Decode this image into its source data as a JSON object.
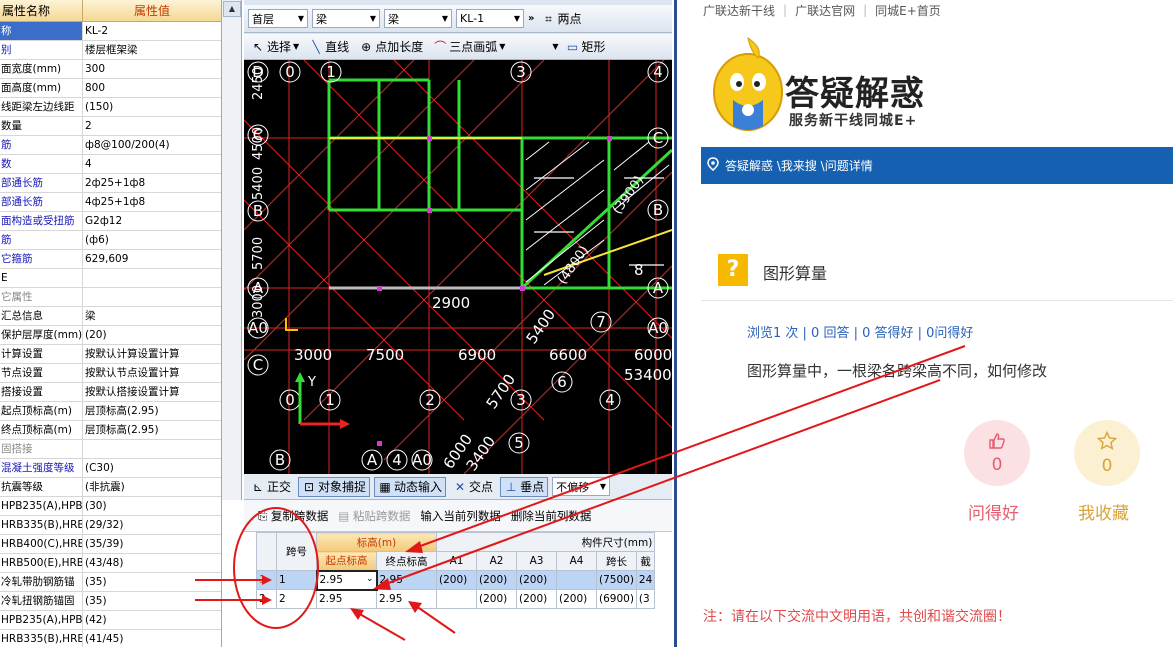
{
  "properties": {
    "header": {
      "name": "属性名称",
      "value": "属性值"
    },
    "rows": [
      {
        "name": "称",
        "value": "KL-2",
        "sel": true
      },
      {
        "name": "别",
        "value": "楼层框架梁",
        "cls": "blue"
      },
      {
        "name": "面宽度(mm)",
        "value": "300"
      },
      {
        "name": "面高度(mm)",
        "value": "800"
      },
      {
        "name": "线距梁左边线距",
        "value": "(150)"
      },
      {
        "name": "数量",
        "value": "2"
      },
      {
        "name": "筋",
        "value": "ф8@100/200(4)",
        "cls": "blue"
      },
      {
        "name": "数",
        "value": "4",
        "cls": "blue"
      },
      {
        "name": "部通长筋",
        "value": "2ф25+1ф8",
        "cls": "blue"
      },
      {
        "name": "部通长筋",
        "value": "4ф25+1ф8",
        "cls": "blue"
      },
      {
        "name": "面构造或受扭筋",
        "value": "G2ф12",
        "cls": "blue"
      },
      {
        "name": "筋",
        "value": "(ф6)",
        "cls": "blue"
      },
      {
        "name": "它箍筋",
        "value": "629,609",
        "cls": "blue"
      },
      {
        "name": "E",
        "value": ""
      },
      {
        "name": "它属性",
        "value": "",
        "cls": "grey"
      },
      {
        "name": "汇总信息",
        "value": "梁"
      },
      {
        "name": "保护层厚度(mm)",
        "value": "(20)"
      },
      {
        "name": "计算设置",
        "value": "按默认计算设置计算"
      },
      {
        "name": "节点设置",
        "value": "按默认节点设置计算"
      },
      {
        "name": "搭接设置",
        "value": "按默认搭接设置计算"
      },
      {
        "name": "起点顶标高(m)",
        "value": "层顶标高(2.95)"
      },
      {
        "name": "终点顶标高(m)",
        "value": "层顶标高(2.95)"
      },
      {
        "name": "固搭接",
        "value": "",
        "cls": "grey"
      },
      {
        "name": "混凝土强度等级",
        "value": "(C30)",
        "cls": "blue"
      },
      {
        "name": "抗震等级",
        "value": "(非抗震)"
      },
      {
        "name": "HPB235(A),HPB3",
        "value": "(30)"
      },
      {
        "name": "HRB335(B),HRB3",
        "value": "(29/32)"
      },
      {
        "name": "HRB400(C),HRB4",
        "value": "(35/39)"
      },
      {
        "name": "HRB500(E),HRB5",
        "value": "(43/48)"
      },
      {
        "name": "冷轧带肋钢筋锚",
        "value": "(35)"
      },
      {
        "name": "冷轧扭钢筋锚固",
        "value": "(35)"
      },
      {
        "name": "HPB235(A),HPB3",
        "value": "(42)"
      },
      {
        "name": "HRB335(B),HRB3",
        "value": "(41/45)"
      }
    ]
  },
  "toolbar1": {
    "floor": "首层",
    "type1": "梁",
    "type2": "梁",
    "member": "KL-1",
    "two_point": "两点"
  },
  "toolbar2": {
    "select": "选择",
    "line": "直线",
    "point_length": "点加长度",
    "arc": "三点画弧",
    "rect": "矩形"
  },
  "snapbar": {
    "ortho": "正交",
    "obj_snap": "对象捕捉",
    "dyn_input": "动态输入",
    "intersect": "交点",
    "perp": "垂点",
    "offset": "不偏移"
  },
  "cad": {
    "axis_labels": {
      "top": [
        "0",
        "1",
        "3",
        "4"
      ],
      "right": [
        "C",
        "B",
        "A",
        "A0",
        "C"
      ],
      "left": [
        "D",
        "C",
        "B",
        "A",
        "A0",
        "C"
      ],
      "bottom": [
        "0",
        "1",
        "2",
        "3",
        "4",
        "5",
        "6",
        "7",
        "B",
        "A",
        "4",
        "A0"
      ],
      "left_dims": [
        "2450",
        "4500",
        "5400",
        "5700",
        "3000"
      ]
    },
    "dims_row": [
      "3000",
      "7500",
      "6900",
      "6600",
      "6000"
    ],
    "dim_53400": "53400",
    "dim_2900": "2900",
    "dim_5400": "5400",
    "dim_5700": "5700",
    "dim_6000": "6000",
    "dim_3400": "3400",
    "dim_4800": "(4800)",
    "dim_3900": "(3900)",
    "label_8": "8",
    "axis_y": "Y"
  },
  "grid": {
    "toolbar": {
      "copy": "复制跨数据",
      "paste": "粘贴跨数据",
      "input_col": "输入当前列数据",
      "delete_col": "删除当前列数据"
    },
    "group_headers": {
      "elev": "标高(m)",
      "dims": "构件尺寸(mm)"
    },
    "columns": [
      "跨号",
      "起点标高",
      "终点标高",
      "A1",
      "A2",
      "A3",
      "A4",
      "跨长",
      "截"
    ],
    "rows": [
      {
        "idx": "1",
        "span": "1",
        "start": "2.95",
        "end": "2.95",
        "a1": "(200)",
        "a2": "(200)",
        "a3": "(200)",
        "a4": "",
        "len": "(7500)",
        "sec": "24"
      },
      {
        "idx": "2",
        "span": "2",
        "start": "2.95",
        "end": "2.95",
        "a1": "",
        "a2": "(200)",
        "a3": "(200)",
        "a4": "(200)",
        "len": "(6900)",
        "sec": "(3"
      }
    ]
  },
  "web": {
    "top_links": [
      "广联达新干线",
      "广联达官网",
      "同城E+首页"
    ],
    "logo_title": "答疑解惑",
    "logo_sub": "服务新干线同城E+",
    "breadcrumb": "答疑解惑 \\我来搜 \\问题详情",
    "question_title": "图形算量",
    "stats": "浏览1 次 | 0 回答 | 0 答得好 | 0问得好",
    "body": "图形算量中，一根梁各跨梁高不同，如何修改",
    "good_count": "0",
    "good_label": "问得好",
    "fav_count": "0",
    "fav_label": "我收藏",
    "note": "注：请在以下交流中文明用语，共创和谐交流圈！"
  },
  "colors": {
    "cad_bg": "#000000",
    "beam_green": "#33dd33",
    "grid_red": "#dd2222",
    "highlight_yellow": "#f5e43a",
    "web_blue": "#1660b1",
    "annotation_red": "#e01818"
  }
}
